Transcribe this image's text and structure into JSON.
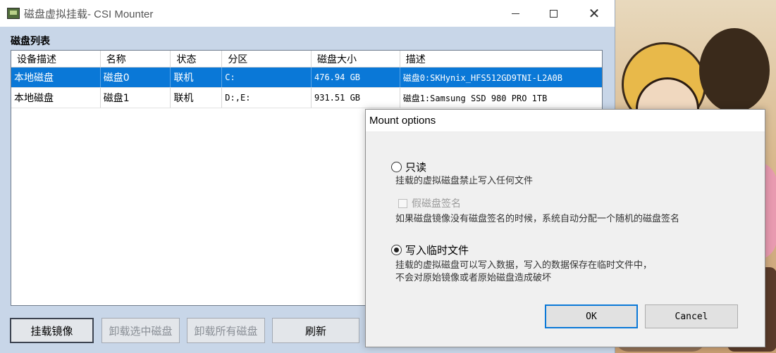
{
  "window": {
    "title": "磁盘虚拟挂载- CSI Mounter",
    "minimize": "minimize",
    "maximize": "maximize",
    "close": "✕"
  },
  "disk_list": {
    "label": "磁盘列表",
    "columns": [
      "设备描述",
      "名称",
      "状态",
      "分区",
      "磁盘大小",
      "描述"
    ],
    "rows": [
      {
        "device": "本地磁盘",
        "name": "磁盘0",
        "status": "联机",
        "partition": "C:",
        "size": "476.94 GB",
        "description": "磁盘0:SKHynix_HFS512GD9TNI-L2A0B",
        "selected": true
      },
      {
        "device": "本地磁盘",
        "name": "磁盘1",
        "status": "联机",
        "partition": "D:,E:",
        "size": "931.51 GB",
        "description": "磁盘1:Samsung SSD 980 PRO 1TB",
        "selected": false
      }
    ]
  },
  "buttons": {
    "mount": "挂载镜像",
    "unmount_selected": "卸载选中磁盘",
    "unmount_all": "卸载所有磁盘",
    "refresh": "刷新"
  },
  "dialog": {
    "title": "Mount options",
    "readonly_label": "只读",
    "readonly_desc": "挂载的虚拟磁盘禁止写入任何文件",
    "fake_sig_label": "假磁盘签名",
    "fake_sig_desc": "如果磁盘镜像没有磁盘签名的时候，系统自动分配一个随机的磁盘签名",
    "temp_label": "写入临时文件",
    "temp_desc_line1": "挂载的虚拟磁盘可以写入数据，写入的数据保存在临时文件中，",
    "temp_desc_line2": "不会对原始镜像或者原始磁盘造成破坏",
    "selected_option": "temp",
    "ok": "OK",
    "cancel": "Cancel"
  },
  "colors": {
    "selection": "#0a78d7",
    "window_bg": "#c8d6e8"
  }
}
